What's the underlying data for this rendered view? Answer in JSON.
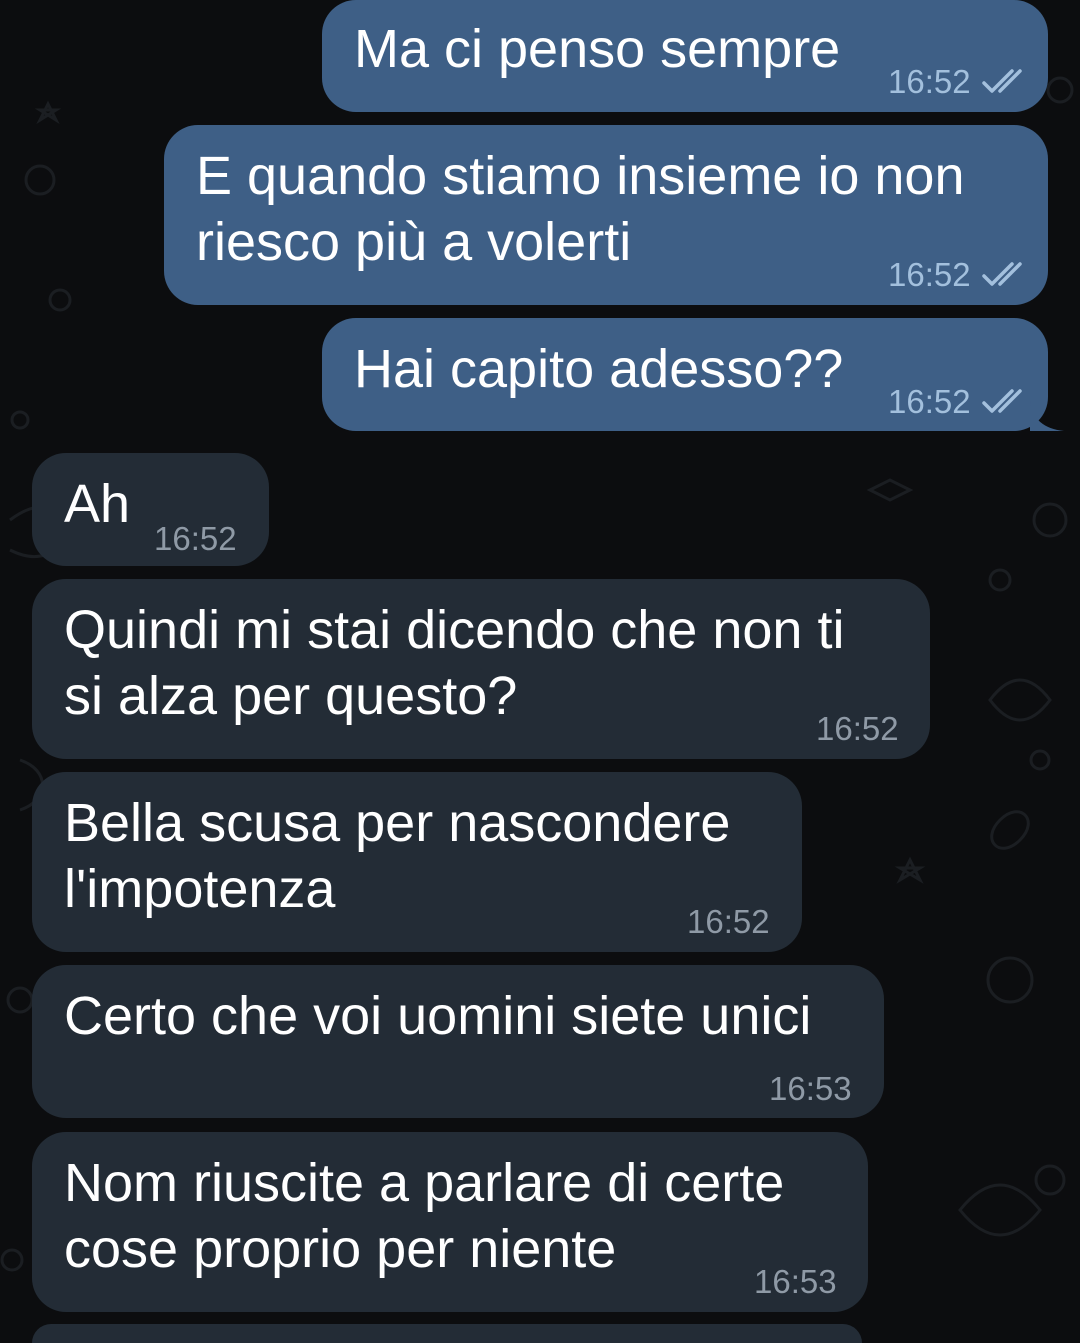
{
  "theme": {
    "background": "#0c0d0f",
    "outgoing_bubble": "#3e5f86",
    "incoming_bubble": "#232c36",
    "outgoing_time": "#a3c0dd",
    "incoming_time": "#8f9aa6",
    "read_ticks": "#a3c0dd"
  },
  "messages": [
    {
      "direction": "out",
      "lines": [
        "Ma ci penso sempre"
      ],
      "time": "16:52",
      "status_icon": "double-check-icon"
    },
    {
      "direction": "out",
      "lines": [
        "E quando stiamo insieme io non",
        "riesco più a volerti"
      ],
      "time": "16:52",
      "status_icon": "double-check-icon"
    },
    {
      "direction": "out",
      "lines": [
        "Hai capito adesso??"
      ],
      "time": "16:52",
      "status_icon": "double-check-icon"
    },
    {
      "direction": "in",
      "lines": [
        "Ah"
      ],
      "time": "16:52"
    },
    {
      "direction": "in",
      "lines": [
        "Quindi mi stai dicendo che non ti",
        "si alza per questo?"
      ],
      "time": "16:52"
    },
    {
      "direction": "in",
      "lines": [
        "Bella scusa per nascondere",
        "l'impotenza"
      ],
      "time": "16:52"
    },
    {
      "direction": "in",
      "lines": [
        "Certo che voi uomini siete unici"
      ],
      "time": "16:53"
    },
    {
      "direction": "in",
      "lines": [
        "Nom riuscite a parlare di certe",
        "cose proprio per niente"
      ],
      "time": "16:53"
    }
  ]
}
